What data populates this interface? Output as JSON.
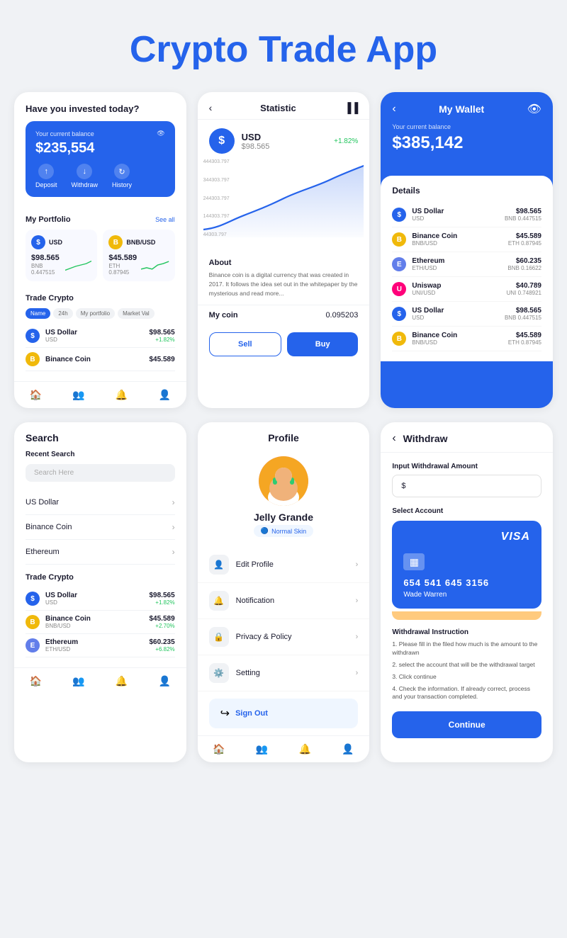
{
  "header": {
    "title_black": "Crypto Trade",
    "title_blue": "App"
  },
  "app1": {
    "question": "Have you invested today?",
    "balance_label": "Your current balance",
    "balance": "$235,554",
    "deposit": "Deposit",
    "withdraw": "Withdraw",
    "history": "History",
    "portfolio_title": "My Portfolio",
    "see_all": "See all",
    "portfolio": [
      {
        "name": "USD",
        "price": "$98.565",
        "sub": "BNB 0.447515",
        "icon": "$",
        "type": "usd"
      },
      {
        "name": "BNB/USD",
        "price": "$45.589",
        "sub": "ETH 0.87945",
        "icon": "B",
        "type": "bnb"
      }
    ],
    "trade_title": "Trade Crypto",
    "filters": [
      "Name",
      "24h",
      "My portfolio",
      "Market Val"
    ],
    "trade_list": [
      {
        "name": "US Dollar",
        "ticker": "USD",
        "price": "$98.565",
        "change": "+1.82%",
        "up": true,
        "icon": "$",
        "type": "usd"
      },
      {
        "name": "Binance Coin",
        "ticker": "",
        "price": "$45.589",
        "change": "",
        "up": true,
        "icon": "B",
        "type": "bnb"
      }
    ]
  },
  "app2": {
    "title": "Statistic",
    "coin_name": "USD",
    "coin_price": "$98.565",
    "coin_change": "+1.82%",
    "chart_labels": [
      "444303.797",
      "344303.797",
      "244303.797",
      "144303.797",
      "44303.797"
    ],
    "about_title": "About",
    "about_text": "Binance coin is a digital currency that was created in 2017. It follows the idea set out in the whitepaper by the mysterious and read more...",
    "my_coin_label": "My coin",
    "my_coin_value": "0.095203",
    "sell_btn": "Sell",
    "buy_btn": "Buy"
  },
  "app3": {
    "title": "My Wallet",
    "balance_label": "Your current balance",
    "balance": "$385,142",
    "details_title": "Details",
    "coins": [
      {
        "name": "US Dollar",
        "ticker": "USD",
        "price": "$98.565",
        "sub": "BNB 0.447515",
        "icon": "$",
        "type": "usd"
      },
      {
        "name": "Binance Coin",
        "ticker": "BNB/USD",
        "price": "$45.589",
        "sub": "ETH 0.87945",
        "icon": "B",
        "type": "bnb"
      },
      {
        "name": "Ethereum",
        "ticker": "ETH/USD",
        "price": "$60.235",
        "sub": "BNB 0.16622",
        "icon": "E",
        "type": "eth"
      },
      {
        "name": "Uniswap",
        "ticker": "UNI/USD",
        "price": "$40.789",
        "sub": "UNI 0.748921",
        "icon": "U",
        "type": "uni"
      },
      {
        "name": "US Dollar",
        "ticker": "USD",
        "price": "$98.565",
        "sub": "BNB 0.447515",
        "icon": "$",
        "type": "usd"
      },
      {
        "name": "Binance Coin",
        "ticker": "BNB/USD",
        "price": "$45.589",
        "sub": "ETH 0.87945",
        "icon": "B",
        "type": "bnb"
      }
    ]
  },
  "app4": {
    "search_title": "Search",
    "recent_title": "Recent Search",
    "search_placeholder": "Search Here",
    "search_items": [
      "US Dollar",
      "Binance Coin",
      "Ethereum"
    ],
    "trade_title": "Trade Crypto",
    "trade_list": [
      {
        "name": "US Dollar",
        "ticker": "USD",
        "price": "$98.565",
        "change": "+1.82%",
        "type": "usd"
      },
      {
        "name": "Binance Coin",
        "ticker": "BNB/USD",
        "price": "$45.589",
        "change": "+2.70%",
        "type": "bnb"
      },
      {
        "name": "Ethereum",
        "ticker": "ETH/USD",
        "price": "$60.235",
        "change": "+6.82%",
        "type": "eth"
      }
    ]
  },
  "app5": {
    "title": "Profile",
    "user_name": "Jelly Grande",
    "user_badge": "Normal Skin",
    "menu": [
      {
        "label": "Edit Profile",
        "icon": "👤"
      },
      {
        "label": "Notification",
        "icon": "🔔"
      },
      {
        "label": "Privacy & Policy",
        "icon": "🔒"
      },
      {
        "label": "Setting",
        "icon": "⚙️"
      }
    ],
    "signout": "Sign Out"
  },
  "app6": {
    "title": "Withdraw",
    "input_label": "Input Withdrawal Amount",
    "input_value": "$",
    "account_label": "Select Account",
    "card_visa": "VISA",
    "card_number": "654 541 645 3156",
    "card_holder": "Wade Warren",
    "instructions_title": "Withdrawal Instruction",
    "instructions": [
      "1. Please fill in the filed how much is the amount to the withdrawn",
      "2. select the account that will be the withdrawal target",
      "3. Click continue",
      "4. Check the information. If already correct, process and your transaction completed."
    ],
    "continue_btn": "Continue"
  }
}
